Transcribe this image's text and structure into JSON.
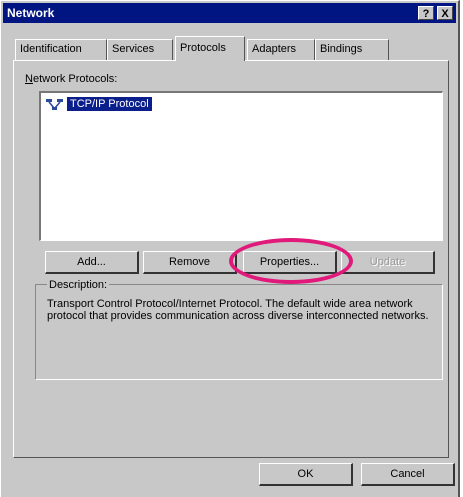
{
  "window": {
    "title": "Network",
    "help_label": "?",
    "close_label": "X"
  },
  "tabs": [
    {
      "label": "Identification"
    },
    {
      "label": "Services"
    },
    {
      "label": "Protocols"
    },
    {
      "label": "Adapters"
    },
    {
      "label": "Bindings"
    }
  ],
  "protocols": {
    "label": "Network Protocols:",
    "items": [
      {
        "label": "TCP/IP Protocol",
        "selected": true,
        "icon": "network-protocol-icon"
      }
    ]
  },
  "buttons": {
    "add": "Add...",
    "remove": "Remove",
    "properties": "Properties...",
    "update": "Update",
    "ok": "OK",
    "cancel": "Cancel"
  },
  "description": {
    "title": "Description:",
    "text": "Transport Control Protocol/Internet Protocol. The default wide area network protocol that provides communication across diverse interconnected networks."
  },
  "colors": {
    "title_bar": "#001482",
    "selection": "#0a1e8c",
    "highlight_ring": "#e0197a",
    "face": "#c8c8c8"
  }
}
